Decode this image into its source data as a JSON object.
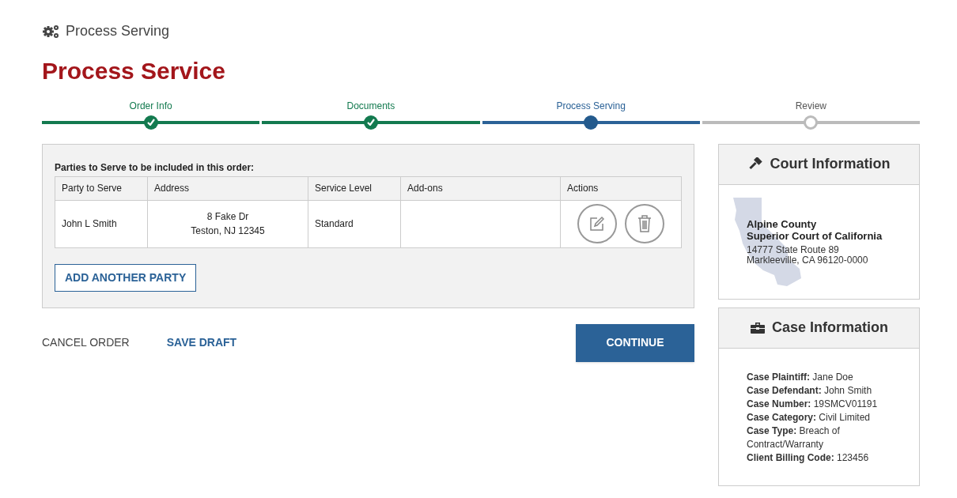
{
  "header": {
    "section": "Process Serving",
    "title": "Process Service"
  },
  "steps": [
    {
      "label": "Order Info",
      "completed": true,
      "selected": false
    },
    {
      "label": "Documents",
      "completed": true,
      "selected": false
    },
    {
      "label": "Process Serving",
      "completed": false,
      "selected": true
    },
    {
      "label": "Review",
      "completed": false,
      "selected": false
    }
  ],
  "parties": {
    "caption": "Parties to Serve to be included in this order:",
    "columns": [
      "Party to Serve",
      "Address",
      "Service Level",
      "Add-ons",
      "Actions"
    ],
    "rows": [
      {
        "party": "John L Smith",
        "address": [
          "8 Fake Dr",
          "Teston, NJ 12345"
        ],
        "service_level": "Standard"
      }
    ],
    "add_button": "ADD ANOTHER PARTY"
  },
  "actions": {
    "cancel": "CANCEL ORDER",
    "save": "SAVE DRAFT",
    "continue": "CONTINUE"
  },
  "court": {
    "title": "Court Information",
    "county": "Alpine County",
    "court": "Superior Court of California",
    "address": [
      "14777 State Route 89",
      "Markleeville, CA 96120-0000"
    ]
  },
  "case": {
    "title": "Case Information",
    "lines": [
      "**Case Plaintiff:** Jane Doe",
      "**Case Defendant:** John Smith",
      "**Case Number:** 19SMCV01191",
      "**Case Category:** Civil Limited",
      "**Case Type:** Breach of Contract/Warranty",
      "**Client Billing Code:** 123456"
    ]
  }
}
